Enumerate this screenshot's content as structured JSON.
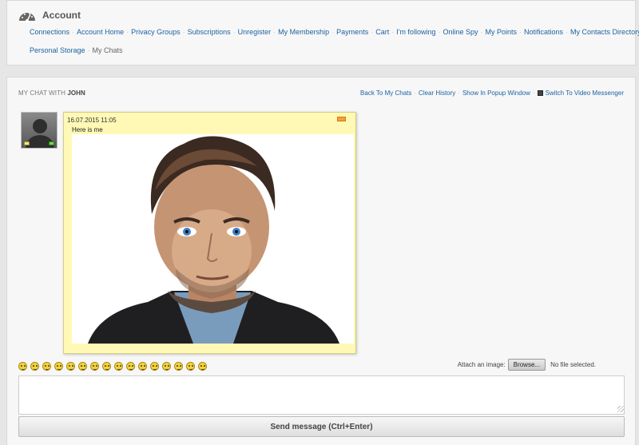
{
  "account": {
    "title": "Account",
    "nav_row1": [
      "Connections",
      "Account Home",
      "Privacy Groups",
      "Subscriptions",
      "Unregister",
      "My Membership",
      "Payments",
      "Cart",
      "I'm following",
      "Online Spy",
      "My Points",
      "Notifications",
      "My Contacts Directory"
    ],
    "nav_row2_links": [
      "Personal Storage"
    ],
    "nav_current": "My Chats"
  },
  "chat": {
    "heading_prefix": "My chat with",
    "partner": "JOHN",
    "actions": [
      "Back To My Chats",
      "Clear History",
      "Show In Popup Window"
    ],
    "video_label": "Switch To Video Messenger",
    "message": {
      "timestamp": "16.07.2015 11:05",
      "text": "Here is me"
    },
    "smileys": [
      "cool",
      "sad",
      "neutral",
      "tongue",
      "confused",
      "angel",
      "happy",
      "grin",
      "sick",
      "worried",
      "surprised",
      "shocked",
      "tongue-out",
      "wink",
      "smile",
      "laugh"
    ],
    "attach_label": "Attach an image:",
    "browse_label": "Browse...",
    "file_status": "No file selected.",
    "textarea_value": "",
    "send_label": "Send message (Ctrl+Enter)"
  },
  "colors": {
    "link": "#1c62a4",
    "message_bg": "#fff9b5",
    "panel_bg": "#f7f7f7",
    "page_bg": "#e6e6e6"
  }
}
